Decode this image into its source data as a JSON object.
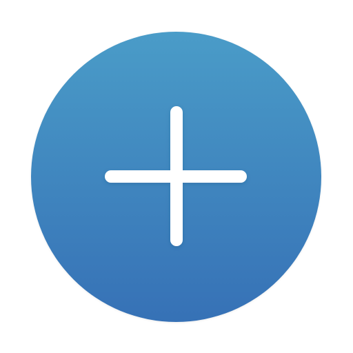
{
  "app_icon": {
    "icon": "plus-icon",
    "shape": "circle",
    "colors": {
      "gradient_top": "#4A9CC8",
      "gradient_bottom": "#3671B6",
      "glyph": "#FFFFFF",
      "background": "#FFFFFF"
    }
  }
}
